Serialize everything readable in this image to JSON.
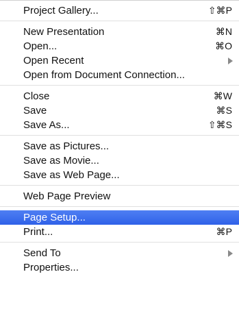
{
  "menu": {
    "groups": [
      {
        "items": [
          {
            "label": "Project Gallery...",
            "shortcut": "⇧⌘P",
            "submenu": false,
            "highlighted": false
          }
        ]
      },
      {
        "items": [
          {
            "label": "New Presentation",
            "shortcut": "⌘N",
            "submenu": false,
            "highlighted": false
          },
          {
            "label": "Open...",
            "shortcut": "⌘O",
            "submenu": false,
            "highlighted": false
          },
          {
            "label": "Open Recent",
            "shortcut": "",
            "submenu": true,
            "highlighted": false
          },
          {
            "label": "Open from Document Connection...",
            "shortcut": "",
            "submenu": false,
            "highlighted": false
          }
        ]
      },
      {
        "items": [
          {
            "label": "Close",
            "shortcut": "⌘W",
            "submenu": false,
            "highlighted": false
          },
          {
            "label": "Save",
            "shortcut": "⌘S",
            "submenu": false,
            "highlighted": false
          },
          {
            "label": "Save As...",
            "shortcut": "⇧⌘S",
            "submenu": false,
            "highlighted": false
          }
        ]
      },
      {
        "items": [
          {
            "label": "Save as Pictures...",
            "shortcut": "",
            "submenu": false,
            "highlighted": false
          },
          {
            "label": "Save as Movie...",
            "shortcut": "",
            "submenu": false,
            "highlighted": false
          },
          {
            "label": "Save as Web Page...",
            "shortcut": "",
            "submenu": false,
            "highlighted": false
          }
        ]
      },
      {
        "items": [
          {
            "label": "Web Page Preview",
            "shortcut": "",
            "submenu": false,
            "highlighted": false
          }
        ]
      },
      {
        "items": [
          {
            "label": "Page Setup...",
            "shortcut": "",
            "submenu": false,
            "highlighted": true
          },
          {
            "label": "Print...",
            "shortcut": "⌘P",
            "submenu": false,
            "highlighted": false
          }
        ]
      },
      {
        "items": [
          {
            "label": "Send To",
            "shortcut": "",
            "submenu": true,
            "highlighted": false
          },
          {
            "label": "Properties...",
            "shortcut": "",
            "submenu": false,
            "highlighted": false
          }
        ]
      }
    ],
    "colors": {
      "highlight": "#3b6ff0",
      "highlight_text": "#ffffff",
      "text": "#111111",
      "separator": "#e0e0e0",
      "submenu_arrow": "#8a8a8a"
    }
  }
}
